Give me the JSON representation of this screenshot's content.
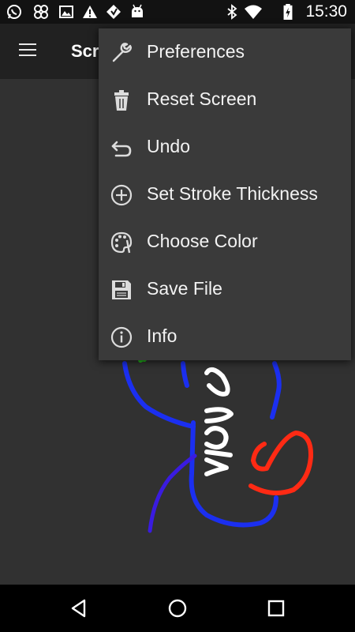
{
  "status_bar": {
    "time": "15:30",
    "left_icons": [
      "whatsapp-icon",
      "pinwheel-icon",
      "image-icon",
      "warning-icon",
      "app-icon",
      "android-icon"
    ],
    "right_icons": [
      "bluetooth-icon",
      "wifi-icon",
      "battery-charging-icon"
    ]
  },
  "toolbar": {
    "title": "Scr"
  },
  "menu": {
    "items": [
      {
        "label": "Preferences",
        "icon": "wrench-icon"
      },
      {
        "label": "Reset Screen",
        "icon": "trash-icon"
      },
      {
        "label": "Undo",
        "icon": "undo-icon"
      },
      {
        "label": "Set Stroke Thickness",
        "icon": "plus-circle-icon"
      },
      {
        "label": "Choose Color",
        "icon": "palette-icon"
      },
      {
        "label": "Save File",
        "icon": "save-icon"
      },
      {
        "label": "Info",
        "icon": "info-icon"
      }
    ]
  },
  "nav_bar": {
    "buttons": [
      "back-icon",
      "home-icon",
      "recents-icon"
    ]
  },
  "colors": {
    "canvas_background": "#313131",
    "toolbar": "#212121",
    "menu_background": "#3a3a3a",
    "stroke_blue": "#1b2ff0",
    "stroke_red": "#ff2a14",
    "stroke_white": "#ffffff",
    "stroke_indigo": "#3a1be0",
    "stroke_green": "#22c01a"
  }
}
